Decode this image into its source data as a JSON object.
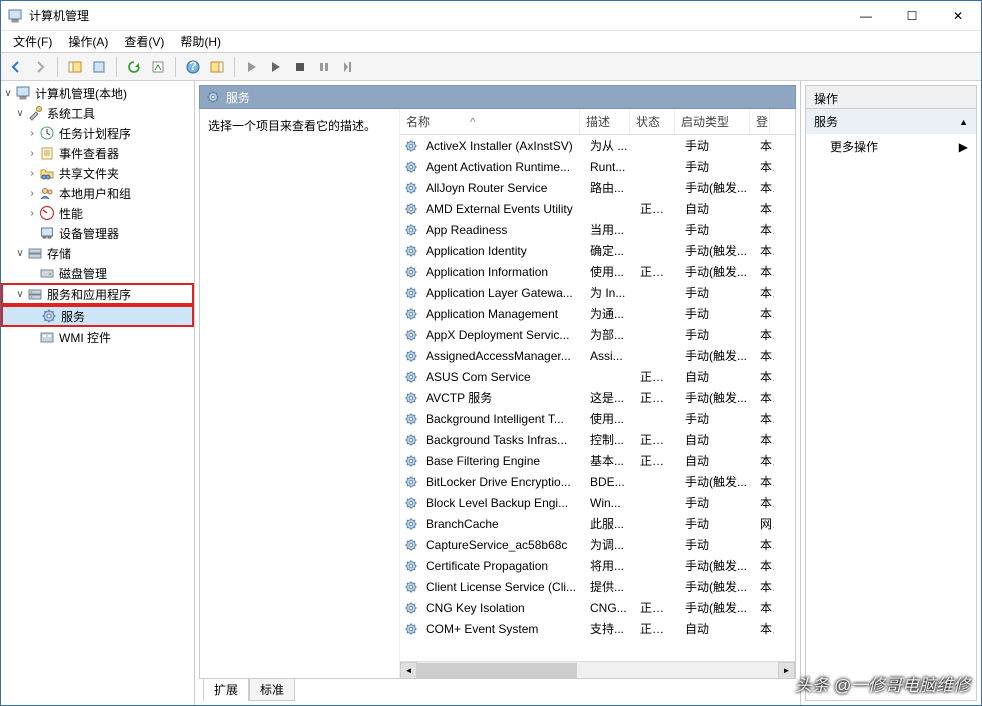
{
  "window": {
    "title": "计算机管理",
    "min": "—",
    "max": "☐",
    "close": "✕"
  },
  "menu": {
    "file": "文件(F)",
    "action": "操作(A)",
    "view": "查看(V)",
    "help": "帮助(H)"
  },
  "nav": {
    "root": "计算机管理(本地)",
    "systools": "系统工具",
    "scheduler": "任务计划程序",
    "eventviewer": "事件查看器",
    "sharedfolders": "共享文件夹",
    "localusers": "本地用户和组",
    "performance": "性能",
    "devicemgr": "设备管理器",
    "storage": "存储",
    "diskmgmt": "磁盘管理",
    "svcapps": "服务和应用程序",
    "services": "服务",
    "wmi": "WMI 控件"
  },
  "mid": {
    "header": "服务",
    "desc_prompt": "选择一个项目来查看它的描述。",
    "cols": {
      "name": "名称",
      "desc": "描述",
      "status": "状态",
      "starttype": "启动类型",
      "logon": "登"
    },
    "rows": [
      {
        "name": "ActiveX Installer (AxInstSV)",
        "desc": "为从 ...",
        "status": "",
        "start": "手动",
        "logon": "本"
      },
      {
        "name": "Agent Activation Runtime...",
        "desc": "Runt...",
        "status": "",
        "start": "手动",
        "logon": "本"
      },
      {
        "name": "AllJoyn Router Service",
        "desc": "路由...",
        "status": "",
        "start": "手动(触发...",
        "logon": "本"
      },
      {
        "name": "AMD External Events Utility",
        "desc": "",
        "status": "正在...",
        "start": "自动",
        "logon": "本"
      },
      {
        "name": "App Readiness",
        "desc": "当用...",
        "status": "",
        "start": "手动",
        "logon": "本"
      },
      {
        "name": "Application Identity",
        "desc": "确定...",
        "status": "",
        "start": "手动(触发...",
        "logon": "本"
      },
      {
        "name": "Application Information",
        "desc": "使用...",
        "status": "正在...",
        "start": "手动(触发...",
        "logon": "本"
      },
      {
        "name": "Application Layer Gatewa...",
        "desc": "为 In...",
        "status": "",
        "start": "手动",
        "logon": "本"
      },
      {
        "name": "Application Management",
        "desc": "为通...",
        "status": "",
        "start": "手动",
        "logon": "本"
      },
      {
        "name": "AppX Deployment Servic...",
        "desc": "为部...",
        "status": "",
        "start": "手动",
        "logon": "本"
      },
      {
        "name": "AssignedAccessManager...",
        "desc": "Assi...",
        "status": "",
        "start": "手动(触发...",
        "logon": "本"
      },
      {
        "name": "ASUS Com Service",
        "desc": "",
        "status": "正在...",
        "start": "自动",
        "logon": "本"
      },
      {
        "name": "AVCTP 服务",
        "desc": "这是...",
        "status": "正在...",
        "start": "手动(触发...",
        "logon": "本"
      },
      {
        "name": "Background Intelligent T...",
        "desc": "使用...",
        "status": "",
        "start": "手动",
        "logon": "本"
      },
      {
        "name": "Background Tasks Infras...",
        "desc": "控制...",
        "status": "正在...",
        "start": "自动",
        "logon": "本"
      },
      {
        "name": "Base Filtering Engine",
        "desc": "基本...",
        "status": "正在...",
        "start": "自动",
        "logon": "本"
      },
      {
        "name": "BitLocker Drive Encryptio...",
        "desc": "BDE...",
        "status": "",
        "start": "手动(触发...",
        "logon": "本"
      },
      {
        "name": "Block Level Backup Engi...",
        "desc": "Win...",
        "status": "",
        "start": "手动",
        "logon": "本"
      },
      {
        "name": "BranchCache",
        "desc": "此服...",
        "status": "",
        "start": "手动",
        "logon": "网"
      },
      {
        "name": "CaptureService_ac58b68c",
        "desc": "为调...",
        "status": "",
        "start": "手动",
        "logon": "本"
      },
      {
        "name": "Certificate Propagation",
        "desc": "将用...",
        "status": "",
        "start": "手动(触发...",
        "logon": "本"
      },
      {
        "name": "Client License Service (Cli...",
        "desc": "提供...",
        "status": "",
        "start": "手动(触发...",
        "logon": "本"
      },
      {
        "name": "CNG Key Isolation",
        "desc": "CNG...",
        "status": "正在...",
        "start": "手动(触发...",
        "logon": "本"
      },
      {
        "name": "COM+ Event System",
        "desc": "支持...",
        "status": "正在...",
        "start": "自动",
        "logon": "本"
      }
    ],
    "tabs": {
      "extended": "扩展",
      "standard": "标准"
    }
  },
  "actions": {
    "header": "操作",
    "section": "服务",
    "more": "更多操作"
  },
  "watermark": "头条 @一修哥电脑维修"
}
